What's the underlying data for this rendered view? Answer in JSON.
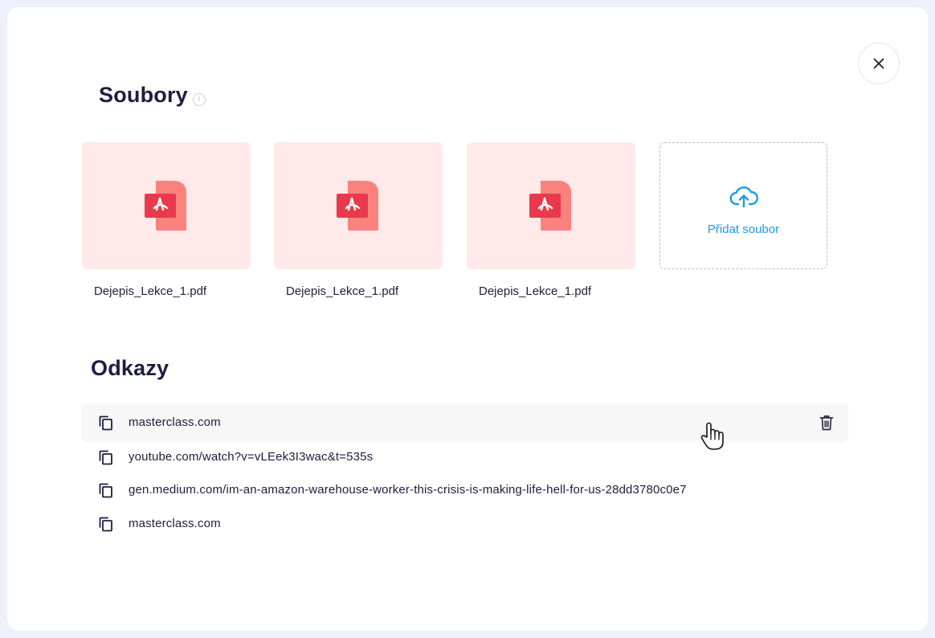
{
  "files_section": {
    "title": "Soubory",
    "info_glyph": "i",
    "files": [
      {
        "name": "Dejepis_Lekce_1.pdf",
        "icon": "pdf-icon"
      },
      {
        "name": "Dejepis_Lekce_1.pdf",
        "icon": "pdf-icon"
      },
      {
        "name": "Dejepis_Lekce_1.pdf",
        "icon": "pdf-icon"
      }
    ],
    "add_label": "Přidat soubor",
    "add_icon": "cloud-upload-icon"
  },
  "links_section": {
    "title": "Odkazy",
    "links": [
      {
        "url": "masterclass.com",
        "hovered": true
      },
      {
        "url": "youtube.com/watch?v=vLEek3I3wac&t=535s",
        "hovered": false
      },
      {
        "url": "gen.medium.com/im-an-amazon-warehouse-worker-this-crisis-is-making-life-hell-for-us-28dd3780c0e7",
        "hovered": false
      },
      {
        "url": "masterclass.com",
        "hovered": false
      }
    ]
  },
  "colors": {
    "accent": "#1c9be0",
    "file_card_bg": "#ffe9e9",
    "pdf_red": "#e8394d",
    "pdf_light": "#f9827f",
    "title": "#1d1d3f"
  }
}
